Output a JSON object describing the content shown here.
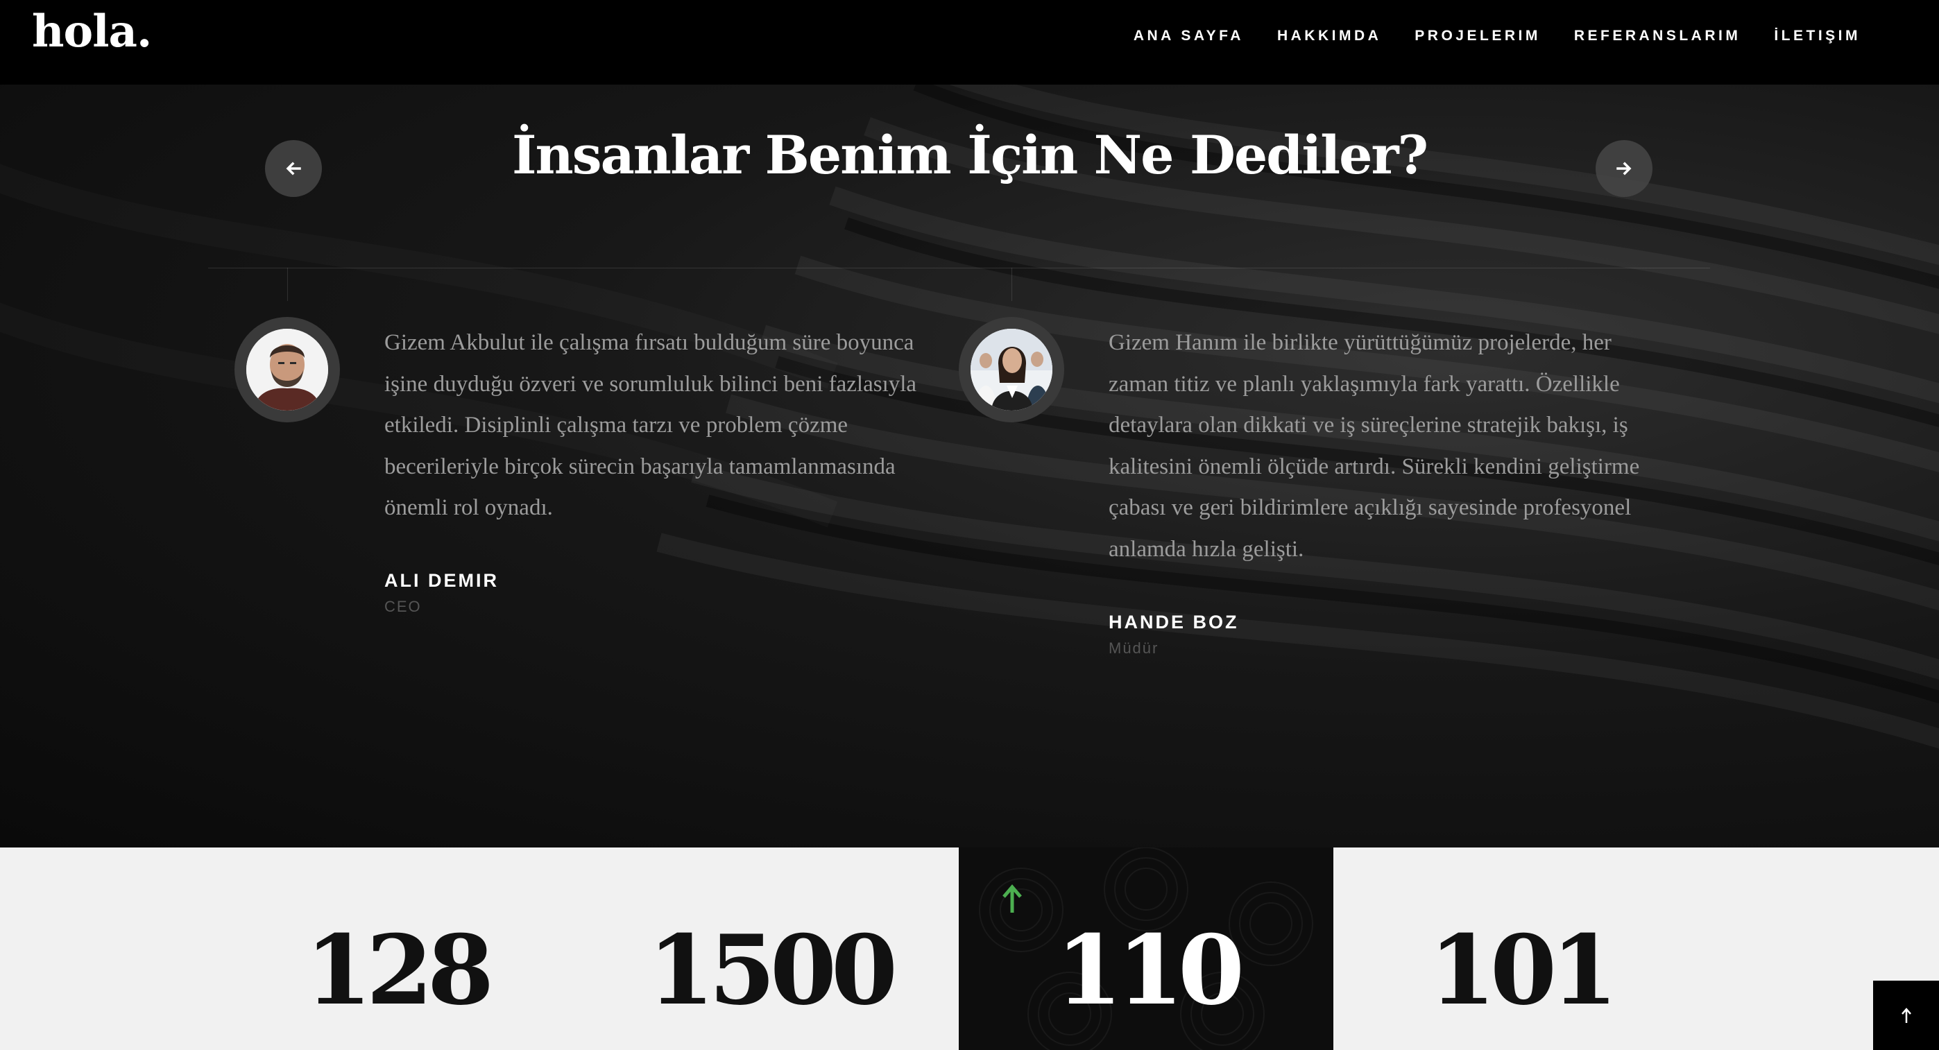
{
  "brand": {
    "logo": "hola."
  },
  "nav": {
    "items": [
      {
        "label": "ANA SAYFA"
      },
      {
        "label": "HAKKIMDA"
      },
      {
        "label": "PROJELERIM"
      },
      {
        "label": "REFERANSLARIM"
      },
      {
        "label": "İLETIŞIM"
      }
    ]
  },
  "testimonials": {
    "title": "İnsanlar Benim İçin Ne Dediler?",
    "prev_icon": "arrow-left-icon",
    "next_icon": "arrow-right-icon",
    "items": [
      {
        "quote": "Gizem Akbulut ile çalışma fırsatı bulduğum süre boyunca işine duyduğu özveri ve sorumluluk bilinci beni fazlasıyla etkiledi. Disiplinli çalışma tarzı ve problem çözme becerileriyle birçok sürecin başarıyla tamamlanmasında önemli rol oynadı.",
        "name": "ALI DEMIR",
        "role": "CEO"
      },
      {
        "quote": "Gizem Hanım ile birlikte yürüttüğümüz projelerde, her zaman titiz ve planlı yaklaşımıyla fark yarattı. Özellikle detaylara olan dikkati ve iş süreçlerine stratejik bakışı, iş kalitesini önemli ölçüde artırdı. Sürekli kendini geliştirme çabası ve geri bildirimlere açıklığı sayesinde profesyonel anlamda hızla gelişti.",
        "name": "HANDE BOZ",
        "role": "Müdür"
      }
    ]
  },
  "stats": {
    "items": [
      {
        "value": "128"
      },
      {
        "value": "1500"
      },
      {
        "value": "110"
      },
      {
        "value": "101"
      }
    ],
    "accent_color": "#4caf50"
  },
  "back_to_top_icon": "arrow-up-icon"
}
